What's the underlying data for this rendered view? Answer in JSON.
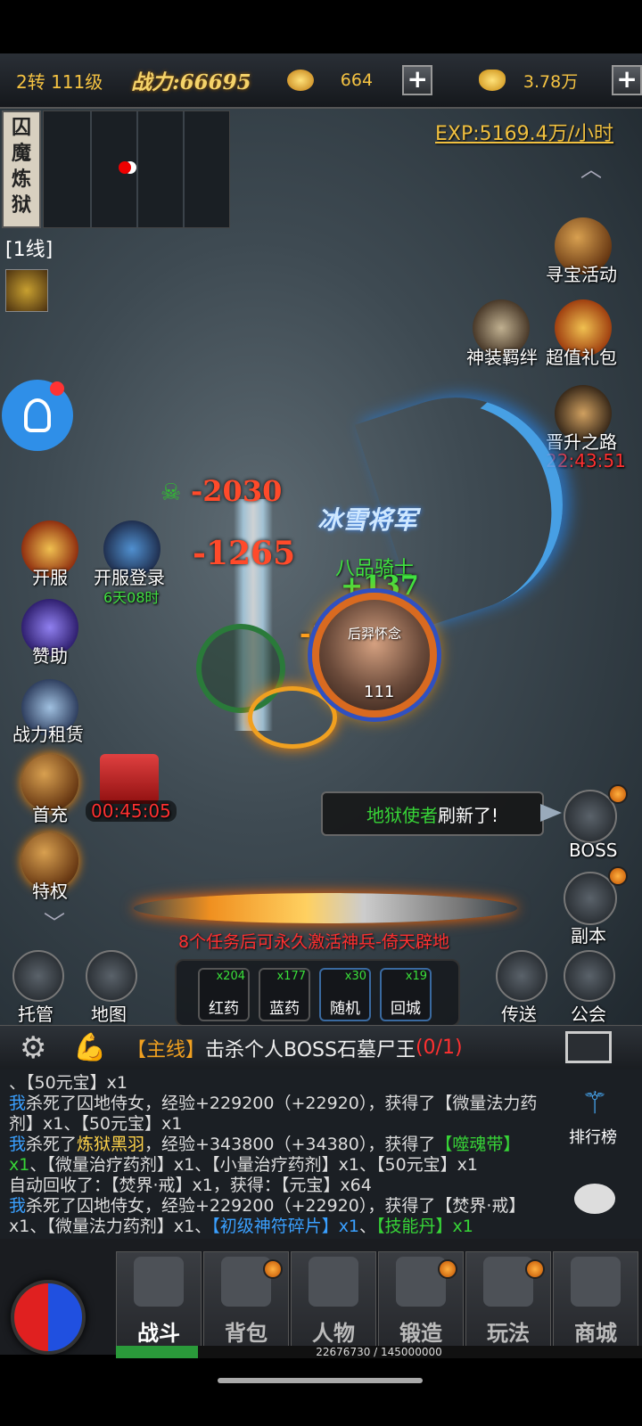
{
  "topbar": {
    "level": "2转 111级",
    "power": "战力:66695",
    "currency1_value": "664",
    "currency2_value": "3.78万",
    "plus_label": "+"
  },
  "map": {
    "zone_name": "囚魔炼狱",
    "line": "[1线]",
    "exp_rate": "EXP:5169.4万/小时"
  },
  "right_icons": {
    "treasure": "寻宝活动",
    "gear_bond": "神装羁绊",
    "super_gift": "超值礼包",
    "ascension": "晋升之路",
    "ascension_timer": "22:43:51",
    "boss": "BOSS",
    "dungeon": "副本",
    "teleport": "传送",
    "guild": "公会"
  },
  "left_icons": {
    "open_server": "开服",
    "open_login": "开服登录",
    "open_login_timer": "6天08时",
    "sponsor": "赞助",
    "power_rent": "战力租赁",
    "first_recharge": "首充",
    "gift_timer": "00:45:05",
    "privilege": "特权",
    "auto": "托管",
    "map": "地图"
  },
  "combat": {
    "dmg1": "-2030",
    "dmg2": "-1265",
    "heal": "+137",
    "dmg3": "-1",
    "title_banner": "冰雪将军",
    "rank_title": "八品骑士",
    "hero_name": "后羿怀念",
    "hero_level": "111"
  },
  "notice": {
    "name": "地狱使者",
    "suffix": "刷新了!"
  },
  "weapon_hint": {
    "prefix": "8个任务后可永久激活",
    "weapon": "神兵-倚天辟地"
  },
  "items": [
    {
      "name": "红药",
      "count": "x204"
    },
    {
      "name": "蓝药",
      "count": "x177"
    },
    {
      "name": "随机",
      "count": "x30"
    },
    {
      "name": "回城",
      "count": "x19"
    }
  ],
  "quest": {
    "tag": "【主线】",
    "text": "击杀个人BOSS石墓尸王",
    "progress": "(0/1)"
  },
  "chat": {
    "line0": "、【50元宝】x1",
    "l1_me": "我",
    "l1_a": "杀死了囚地侍女，经验+229200（+22920），获得了【微量法力药剂】x1、【50元宝】x1",
    "l2_me": "我",
    "l2_a": "杀死了",
    "l2_mon": "炼狱黑羽",
    "l2_b": "，经验+343800（+34380），获得了",
    "l2_item": "【噬魂带】x1",
    "l2_c": "、【微量治疗药剂】x1、【小量治疗药剂】x1、【50元宝】x1",
    "l3": "自动回收了：【焚界·戒】x1，获得：【元宝】x64",
    "l4_me": "我",
    "l4_a": "杀死了囚地侍女，经验+229200（+22920），获得了【焚界·戒】x1",
    "l4_b": "、【微量法力药剂】x1、",
    "l4_item1": "【初级神符碎片】x1",
    "l4_c": "、",
    "l4_item2": "【技能丹】x1",
    "ranking": "排行榜"
  },
  "nav": [
    "战斗",
    "背包",
    "人物",
    "锻造",
    "玩法",
    "商城"
  ],
  "xp": {
    "text": "22676730 / 145000000",
    "fraction": 0.156
  }
}
